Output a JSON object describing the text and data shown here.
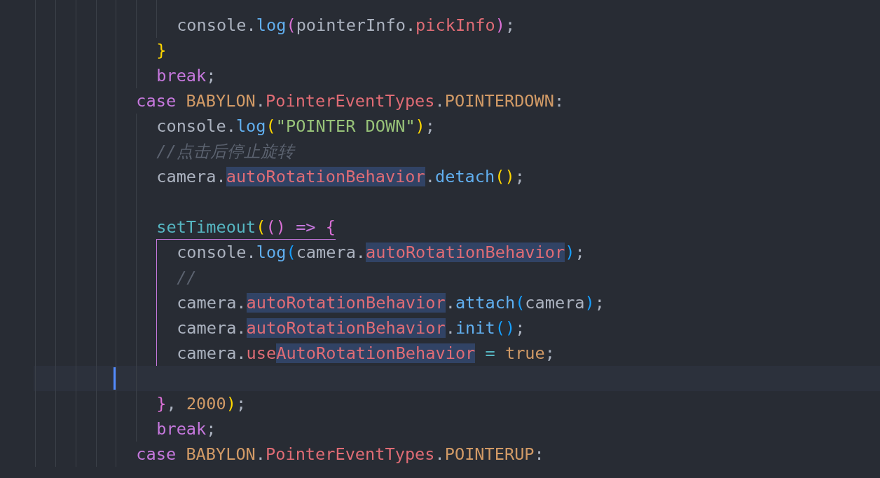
{
  "editor": {
    "lines": [
      {
        "kind": "group",
        "children": [
          {
            "kind": "group",
            "children": [
              {
                "kind": "blank",
                "current": false
              },
              {
                "kind": "code",
                "current": false,
                "tokens": [
                  {
                    "text": "console",
                    "kind": "plain"
                  },
                  {
                    "text": ".",
                    "kind": "punct"
                  },
                  {
                    "text": "log",
                    "kind": "func"
                  },
                  {
                    "text": "(",
                    "kind": "bracket2"
                  },
                  {
                    "text": "pointerInfo",
                    "kind": "plain"
                  },
                  {
                    "text": ".",
                    "kind": "punct"
                  },
                  {
                    "text": "pickInfo",
                    "kind": "prop"
                  },
                  {
                    "text": ")",
                    "kind": "bracket2"
                  },
                  {
                    "text": ";",
                    "kind": "punct"
                  }
                ]
              }
            ]
          },
          {
            "kind": "code",
            "current": false,
            "tokens": [
              {
                "text": "}",
                "kind": "bracket1"
              }
            ]
          },
          {
            "kind": "code",
            "current": false,
            "tokens": [
              {
                "text": "break",
                "kind": "keyword"
              },
              {
                "text": ";",
                "kind": "punct"
              }
            ]
          }
        ]
      },
      {
        "kind": "code",
        "current": false,
        "tokens": [
          {
            "text": "case",
            "kind": "keyword"
          },
          {
            "text": " BABYLON",
            "kind": "class"
          },
          {
            "text": ".",
            "kind": "punct"
          },
          {
            "text": "PointerEventTypes",
            "kind": "prop"
          },
          {
            "text": ".",
            "kind": "punct"
          },
          {
            "text": "POINTERDOWN",
            "kind": "class"
          },
          {
            "text": ":",
            "kind": "punct"
          }
        ],
        "children": [
          {
            "kind": "code",
            "current": false,
            "tokens": [
              {
                "text": "console",
                "kind": "plain"
              },
              {
                "text": ".",
                "kind": "punct"
              },
              {
                "text": "log",
                "kind": "func"
              },
              {
                "text": "(",
                "kind": "bracket1"
              },
              {
                "text": "\"POINTER DOWN\"",
                "kind": "string"
              },
              {
                "text": ")",
                "kind": "bracket1"
              },
              {
                "text": ";",
                "kind": "punct"
              }
            ]
          },
          {
            "kind": "code",
            "current": false,
            "tokens": [
              {
                "text": "//点击后停止旋转",
                "kind": "comment"
              }
            ]
          },
          {
            "kind": "code",
            "current": false,
            "tokens": [
              {
                "text": "camera",
                "kind": "plain"
              },
              {
                "text": ".",
                "kind": "punct"
              },
              {
                "text": "autoRotationBehavior",
                "kind": "prop",
                "highlighted": true
              },
              {
                "text": ".",
                "kind": "punct"
              },
              {
                "text": "detach",
                "kind": "func"
              },
              {
                "text": "()",
                "kind": "bracket1"
              },
              {
                "text": ";",
                "kind": "punct"
              }
            ]
          },
          {
            "kind": "blank",
            "current": false
          },
          {
            "kind": "code",
            "current": false,
            "active": true,
            "tokens": [
              {
                "text": "setTimeout",
                "kind": "builtin"
              },
              {
                "text": "(",
                "kind": "bracket1"
              },
              {
                "text": "()",
                "kind": "bracket2"
              },
              {
                "text": " =>",
                "kind": "keyword"
              },
              {
                "text": " {",
                "kind": "bracket2"
              }
            ],
            "children": [
              {
                "kind": "code",
                "current": false,
                "tokens": [
                  {
                    "text": "console",
                    "kind": "plain"
                  },
                  {
                    "text": ".",
                    "kind": "punct"
                  },
                  {
                    "text": "log",
                    "kind": "func"
                  },
                  {
                    "text": "(",
                    "kind": "bracket3"
                  },
                  {
                    "text": "camera",
                    "kind": "plain"
                  },
                  {
                    "text": ".",
                    "kind": "punct"
                  },
                  {
                    "text": "autoRotationBehavior",
                    "kind": "prop",
                    "highlighted": true
                  },
                  {
                    "text": ")",
                    "kind": "bracket3"
                  },
                  {
                    "text": ";",
                    "kind": "punct"
                  }
                ]
              },
              {
                "kind": "code",
                "current": false,
                "tokens": [
                  {
                    "text": "//",
                    "kind": "comment"
                  }
                ]
              },
              {
                "kind": "code",
                "current": false,
                "tokens": [
                  {
                    "text": "camera",
                    "kind": "plain"
                  },
                  {
                    "text": ".",
                    "kind": "punct"
                  },
                  {
                    "text": "autoRotationBehavior",
                    "kind": "prop",
                    "highlighted": true
                  },
                  {
                    "text": ".",
                    "kind": "punct"
                  },
                  {
                    "text": "attach",
                    "kind": "func"
                  },
                  {
                    "text": "(",
                    "kind": "bracket3"
                  },
                  {
                    "text": "camera",
                    "kind": "plain"
                  },
                  {
                    "text": ")",
                    "kind": "bracket3"
                  },
                  {
                    "text": ";",
                    "kind": "punct"
                  }
                ]
              },
              {
                "kind": "code",
                "current": false,
                "tokens": [
                  {
                    "text": "camera",
                    "kind": "plain"
                  },
                  {
                    "text": ".",
                    "kind": "punct"
                  },
                  {
                    "text": "autoRotationBehavior",
                    "kind": "prop",
                    "highlighted": true
                  },
                  {
                    "text": ".",
                    "kind": "punct"
                  },
                  {
                    "text": "init",
                    "kind": "func"
                  },
                  {
                    "text": "()",
                    "kind": "bracket3"
                  },
                  {
                    "text": ";",
                    "kind": "punct"
                  }
                ]
              },
              {
                "kind": "code",
                "current": false,
                "tokens": [
                  {
                    "text": "camera",
                    "kind": "plain"
                  },
                  {
                    "text": ".",
                    "kind": "punct"
                  },
                  {
                    "text": "use",
                    "kind": "prop"
                  },
                  {
                    "text": "AutoRotationBehavior",
                    "kind": "prop",
                    "highlighted": true
                  },
                  {
                    "text": " =",
                    "kind": "operator"
                  },
                  {
                    "text": " true",
                    "kind": "number"
                  },
                  {
                    "text": ";",
                    "kind": "punct"
                  }
                ]
              },
              {
                "kind": "blank",
                "current": true
              }
            ]
          },
          {
            "kind": "code",
            "current": false,
            "tokens": [
              {
                "text": "}",
                "kind": "bracket2"
              },
              {
                "text": ",",
                "kind": "punct"
              },
              {
                "text": " 2000",
                "kind": "number"
              },
              {
                "text": ")",
                "kind": "bracket1"
              },
              {
                "text": ";",
                "kind": "punct"
              }
            ]
          },
          {
            "kind": "code",
            "current": false,
            "tokens": [
              {
                "text": "break",
                "kind": "keyword"
              },
              {
                "text": ";",
                "kind": "punct"
              }
            ]
          }
        ]
      },
      {
        "kind": "code",
        "current": false,
        "tokens": [
          {
            "text": "case",
            "kind": "keyword"
          },
          {
            "text": " BABYLON",
            "kind": "class"
          },
          {
            "text": ".",
            "kind": "punct"
          },
          {
            "text": "PointerEventTypes",
            "kind": "prop"
          },
          {
            "text": ".",
            "kind": "punct"
          },
          {
            "text": "POINTERUP",
            "kind": "class"
          },
          {
            "text": ":",
            "kind": "punct"
          }
        ]
      }
    ]
  }
}
